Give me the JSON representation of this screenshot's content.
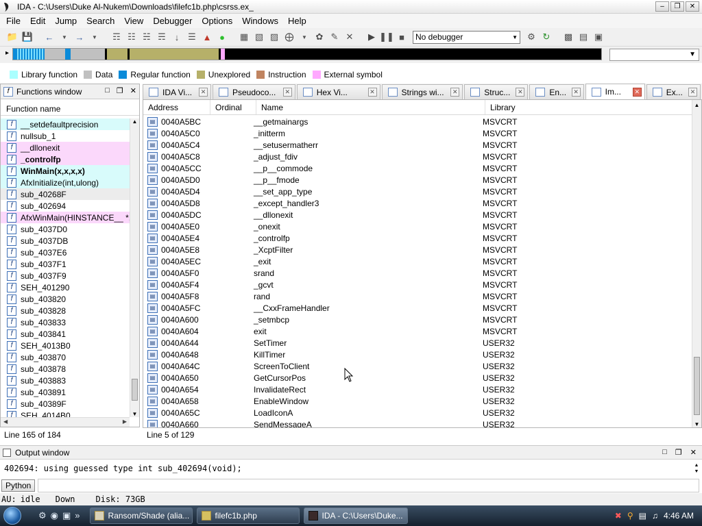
{
  "window": {
    "title": "IDA - C:\\Users\\Duke Al-Nukem\\Downloads\\filefc1b.php\\csrss.ex_"
  },
  "menu": [
    "File",
    "Edit",
    "Jump",
    "Search",
    "View",
    "Debugger",
    "Options",
    "Windows",
    "Help"
  ],
  "toolbar": {
    "debugger_select": "No debugger"
  },
  "colors": {
    "library": "#aaffff",
    "data": "#c0c0c0",
    "regular": "#0b8bd9",
    "unexplored": "#b6b069",
    "instruction": "#c08460",
    "external": "#ffa8ff",
    "nav_library": "#7fe0ff",
    "nav_unexplored": "#b6b069"
  },
  "legend": [
    {
      "label": "Library function",
      "color": "#aaffff"
    },
    {
      "label": "Data",
      "color": "#c0c0c0"
    },
    {
      "label": "Regular function",
      "color": "#0b8bd9"
    },
    {
      "label": "Unexplored",
      "color": "#b6b069"
    },
    {
      "label": "Instruction",
      "color": "#c08460"
    },
    {
      "label": "External symbol",
      "color": "#ffa8ff"
    }
  ],
  "functions_window": {
    "title": "Functions window",
    "column": "Function name",
    "status": "Line 165 of 184",
    "items": [
      {
        "name": "__setdefaultprecision",
        "bg": "#d8fbfb",
        "bold": false
      },
      {
        "name": "nullsub_1",
        "bg": "#ffffff",
        "bold": false
      },
      {
        "name": "__dllonexit",
        "bg": "#fbd8fb",
        "bold": false
      },
      {
        "name": "_controlfp",
        "bg": "#fbd8fb",
        "bold": true
      },
      {
        "name": "WinMain(x,x,x,x)",
        "bg": "#d8fbfb",
        "bold": true
      },
      {
        "name": "AfxInitialize(int,ulong)",
        "bg": "#d8fbfb",
        "bold": false
      },
      {
        "name": "sub_40268F",
        "bg": "#ececec",
        "bold": false
      },
      {
        "name": "sub_402694",
        "bg": "#ffffff",
        "bold": false
      },
      {
        "name": "AfxWinMain(HINSTANCE__ *,H",
        "bg": "#fbd8fb",
        "bold": false
      },
      {
        "name": "sub_4037D0",
        "bg": "#ffffff",
        "bold": false
      },
      {
        "name": "sub_4037DB",
        "bg": "#ffffff",
        "bold": false
      },
      {
        "name": "sub_4037E6",
        "bg": "#ffffff",
        "bold": false
      },
      {
        "name": "sub_4037F1",
        "bg": "#ffffff",
        "bold": false
      },
      {
        "name": "sub_4037F9",
        "bg": "#ffffff",
        "bold": false
      },
      {
        "name": "SEH_401290",
        "bg": "#ffffff",
        "bold": false
      },
      {
        "name": "sub_403820",
        "bg": "#ffffff",
        "bold": false
      },
      {
        "name": "sub_403828",
        "bg": "#ffffff",
        "bold": false
      },
      {
        "name": "sub_403833",
        "bg": "#ffffff",
        "bold": false
      },
      {
        "name": "sub_403841",
        "bg": "#ffffff",
        "bold": false
      },
      {
        "name": "SEH_4013B0",
        "bg": "#ffffff",
        "bold": false
      },
      {
        "name": "sub_403870",
        "bg": "#ffffff",
        "bold": false
      },
      {
        "name": "sub_403878",
        "bg": "#ffffff",
        "bold": false
      },
      {
        "name": "sub_403883",
        "bg": "#ffffff",
        "bold": false
      },
      {
        "name": "sub_403891",
        "bg": "#ffffff",
        "bold": false
      },
      {
        "name": "sub_40389F",
        "bg": "#ffffff",
        "bold": false
      },
      {
        "name": "SEH_4014B0",
        "bg": "#ffffff",
        "bold": false
      }
    ]
  },
  "tabs": [
    {
      "label": "IDA Vi...",
      "active": false
    },
    {
      "label": "Pseudoco...",
      "active": false
    },
    {
      "label": "Hex Vi...",
      "active": false
    },
    {
      "label": "Strings wi...",
      "active": false
    },
    {
      "label": "Struc...",
      "active": false
    },
    {
      "label": "En...",
      "active": false
    },
    {
      "label": "Im...",
      "active": true
    },
    {
      "label": "Ex...",
      "active": false
    }
  ],
  "imports": {
    "columns": {
      "address": "Address",
      "ordinal": "Ordinal",
      "name": "Name",
      "library": "Library"
    },
    "status": "Line 5 of 129",
    "rows": [
      {
        "address": "0040A5BC",
        "name": "__getmainargs",
        "library": "MSVCRT"
      },
      {
        "address": "0040A5C0",
        "name": "_initterm",
        "library": "MSVCRT"
      },
      {
        "address": "0040A5C4",
        "name": "__setusermatherr",
        "library": "MSVCRT"
      },
      {
        "address": "0040A5C8",
        "name": "_adjust_fdiv",
        "library": "MSVCRT"
      },
      {
        "address": "0040A5CC",
        "name": "__p__commode",
        "library": "MSVCRT"
      },
      {
        "address": "0040A5D0",
        "name": "__p__fmode",
        "library": "MSVCRT"
      },
      {
        "address": "0040A5D4",
        "name": "__set_app_type",
        "library": "MSVCRT"
      },
      {
        "address": "0040A5D8",
        "name": "_except_handler3",
        "library": "MSVCRT"
      },
      {
        "address": "0040A5DC",
        "name": "__dllonexit",
        "library": "MSVCRT"
      },
      {
        "address": "0040A5E0",
        "name": "_onexit",
        "library": "MSVCRT"
      },
      {
        "address": "0040A5E4",
        "name": "_controlfp",
        "library": "MSVCRT"
      },
      {
        "address": "0040A5E8",
        "name": "_XcptFilter",
        "library": "MSVCRT"
      },
      {
        "address": "0040A5EC",
        "name": "_exit",
        "library": "MSVCRT"
      },
      {
        "address": "0040A5F0",
        "name": "srand",
        "library": "MSVCRT"
      },
      {
        "address": "0040A5F4",
        "name": "_gcvt",
        "library": "MSVCRT"
      },
      {
        "address": "0040A5F8",
        "name": "rand",
        "library": "MSVCRT"
      },
      {
        "address": "0040A5FC",
        "name": "__CxxFrameHandler",
        "library": "MSVCRT"
      },
      {
        "address": "0040A600",
        "name": "_setmbcp",
        "library": "MSVCRT"
      },
      {
        "address": "0040A604",
        "name": "exit",
        "library": "MSVCRT"
      },
      {
        "address": "0040A644",
        "name": "SetTimer",
        "library": "USER32"
      },
      {
        "address": "0040A648",
        "name": "KillTimer",
        "library": "USER32"
      },
      {
        "address": "0040A64C",
        "name": "ScreenToClient",
        "library": "USER32"
      },
      {
        "address": "0040A650",
        "name": "GetCursorPos",
        "library": "USER32"
      },
      {
        "address": "0040A654",
        "name": "InvalidateRect",
        "library": "USER32"
      },
      {
        "address": "0040A658",
        "name": "EnableWindow",
        "library": "USER32"
      },
      {
        "address": "0040A65C",
        "name": "LoadIconA",
        "library": "USER32"
      },
      {
        "address": "0040A660",
        "name": "SendMessageA",
        "library": "USER32"
      }
    ]
  },
  "output": {
    "title": "Output window",
    "text": "402694: using guessed type int sub_402694(void);",
    "python_button": "Python"
  },
  "statusbar": {
    "au": "AU:",
    "state": "idle",
    "direction": "Down",
    "disk": "Disk: 73GB"
  },
  "taskbar": {
    "tasks": [
      "Ransom/Shade (alia...",
      "filefc1b.php",
      "IDA - C:\\Users\\Duke..."
    ],
    "clock": "4:46 AM"
  }
}
